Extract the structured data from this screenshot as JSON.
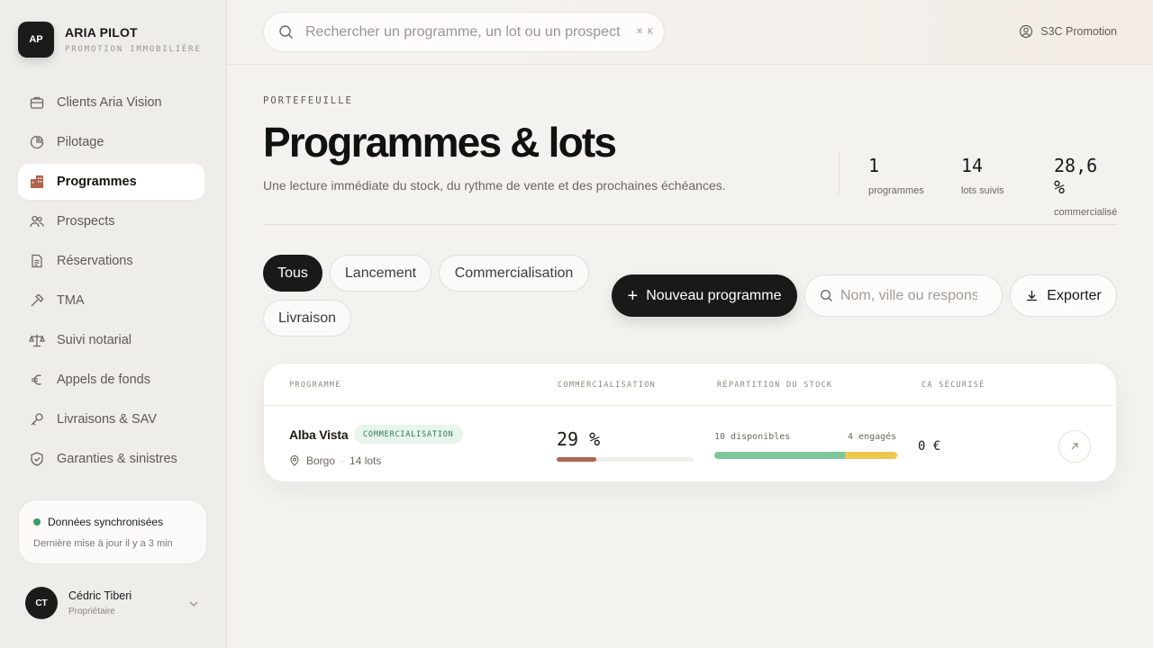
{
  "brand": {
    "initials": "AP",
    "name": "ARIA PILOT",
    "subtitle": "PROMOTION IMMOBILIÈRE"
  },
  "sidebar": {
    "items": [
      {
        "label": "Clients Aria Vision",
        "icon": "briefcase-icon"
      },
      {
        "label": "Pilotage",
        "icon": "pie-chart-icon"
      },
      {
        "label": "Programmes",
        "icon": "building-icon",
        "active": true
      },
      {
        "label": "Prospects",
        "icon": "users-icon"
      },
      {
        "label": "Réservations",
        "icon": "document-icon"
      },
      {
        "label": "TMA",
        "icon": "hammer-icon"
      },
      {
        "label": "Suivi notarial",
        "icon": "scale-icon"
      },
      {
        "label": "Appels de fonds",
        "icon": "euro-icon"
      },
      {
        "label": "Livraisons & SAV",
        "icon": "key-icon"
      },
      {
        "label": "Garanties & sinistres",
        "icon": "shield-icon"
      }
    ],
    "sync": {
      "title": "Données synchronisées",
      "subtitle": "Dernière mise à jour il y a 3 min",
      "status_color": "#3f9a68"
    },
    "user": {
      "initials": "CT",
      "name": "Cédric Tiberi",
      "role": "Propriétaire"
    }
  },
  "topbar": {
    "search_placeholder": "Rechercher un programme, un lot ou un prospect",
    "shortcut": "⌘ K",
    "org_name": "S3C Promotion"
  },
  "header": {
    "eyebrow": "PORTEFEUILLE",
    "title": "Programmes & lots",
    "subtitle": "Une lecture immédiate du stock, du rythme de vente et des prochaines échéances.",
    "stats": [
      {
        "value": "1",
        "label": "programmes"
      },
      {
        "value": "14",
        "label": "lots suivis"
      },
      {
        "value": "28,6 %",
        "label": "commercialisé"
      }
    ]
  },
  "filters": {
    "chips": [
      "Tous",
      "Lancement",
      "Commercialisation",
      "Livraison"
    ],
    "active_chip": "Tous",
    "new_button": "Nouveau programme",
    "filter_placeholder": "Nom, ville ou responsable",
    "export_button": "Exporter"
  },
  "table": {
    "headers": [
      "PROGRAMME",
      "COMMERCIALISATION",
      "RÉPARTITION DU STOCK",
      "CA SÉCURISÉ"
    ],
    "rows": [
      {
        "name": "Alba Vista",
        "status": "COMMERCIALISATION",
        "city": "Borgo",
        "lots": "14 lots",
        "commercialisation": "29 %",
        "commercialisation_fraction": 0.29,
        "available_label": "10 disponibles",
        "engaged_label": "4 engagés",
        "available": 10,
        "engaged": 4,
        "ca": "0 €"
      }
    ]
  },
  "colors": {
    "accent_dark": "#1a1917",
    "progress": "#b0644f",
    "available": "#7ec79b",
    "engaged": "#efc64d",
    "badge_bg": "#e7f5ec",
    "badge_text": "#2f7a52",
    "sidebar_active_icon": "#b0644f"
  }
}
